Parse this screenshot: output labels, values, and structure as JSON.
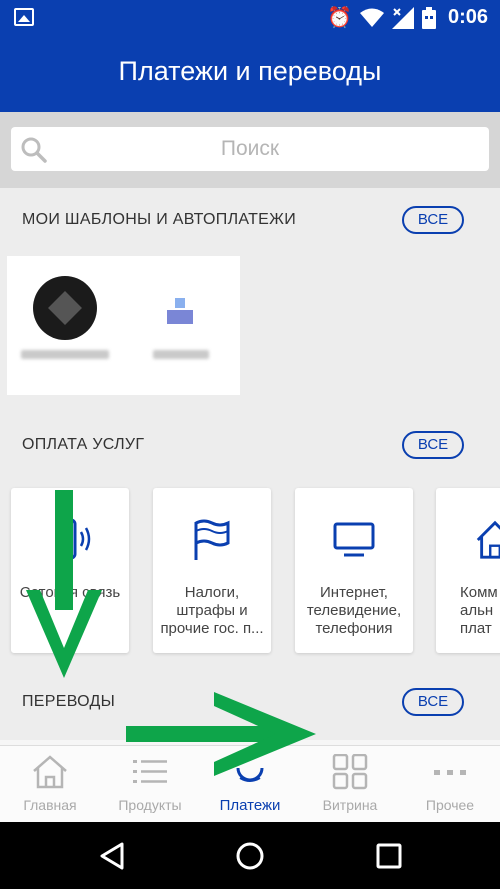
{
  "status_bar": {
    "time": "0:06",
    "icons": [
      "gallery-icon",
      "alarm-icon",
      "wifi-icon",
      "signal-icon",
      "battery-icon"
    ]
  },
  "app_bar": {
    "title": "Платежи и переводы"
  },
  "search": {
    "placeholder": "Поиск"
  },
  "sections": {
    "templates": {
      "title": "МОИ ШАБЛОНЫ И АВТОПЛАТЕЖИ",
      "all_label": "ВСЕ"
    },
    "services": {
      "title": "ОПЛАТА УСЛУГ",
      "all_label": "ВСЕ"
    },
    "transfers": {
      "title": "ПЕРЕВОДЫ",
      "all_label": "ВСЕ"
    }
  },
  "services": [
    {
      "label": "Сотовая связь",
      "icon": "phone-icon"
    },
    {
      "label": "Налоги, штрафы и прочие гос. п...",
      "icon": "flag-icon"
    },
    {
      "label": "Интернет, телевидение, телефония",
      "icon": "tv-icon"
    },
    {
      "label": "Комм альн плат",
      "icon": "house-icon"
    }
  ],
  "bottom_nav": [
    {
      "label": "Главная",
      "icon": "home-icon",
      "active": false
    },
    {
      "label": "Продукты",
      "icon": "list-icon",
      "active": false
    },
    {
      "label": "Платежи",
      "icon": "payments-icon",
      "active": true
    },
    {
      "label": "Витрина",
      "icon": "grid-icon",
      "active": false
    },
    {
      "label": "Прочее",
      "icon": "more-icon",
      "active": false
    }
  ],
  "colors": {
    "brand": "#0a3fb0",
    "arrow": "#0ea54a",
    "nav_inactive": "#a9a9a9"
  }
}
